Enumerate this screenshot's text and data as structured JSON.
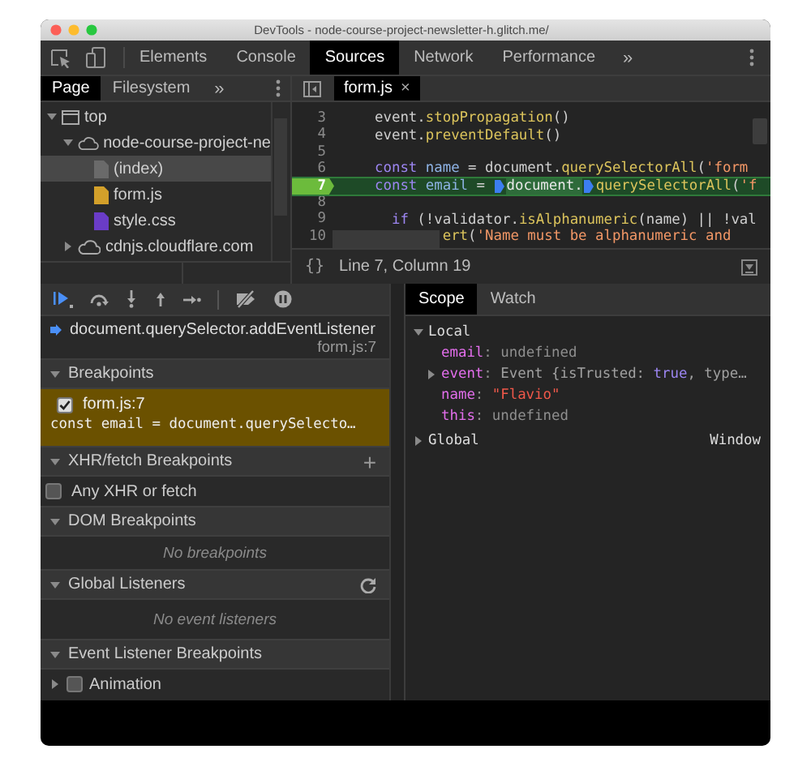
{
  "window": {
    "title": "DevTools - node-course-project-newsletter-h.glitch.me/"
  },
  "main_tabs": [
    {
      "label": "Elements",
      "selected": false
    },
    {
      "label": "Console",
      "selected": false
    },
    {
      "label": "Sources",
      "selected": true
    },
    {
      "label": "Network",
      "selected": false
    },
    {
      "label": "Performance",
      "selected": false
    }
  ],
  "more_tabs": "»",
  "navigator": {
    "tabs": [
      {
        "label": "Page",
        "selected": true
      },
      {
        "label": "Filesystem",
        "selected": false
      }
    ],
    "more_tabs": "»",
    "tree": [
      {
        "label": "top",
        "kind": "frame",
        "expanded": true,
        "selected": false,
        "children": [
          {
            "label": "node-course-project-ne",
            "kind": "domain",
            "expanded": true,
            "selected": false,
            "children": [
              {
                "label": "(index)",
                "kind": "document",
                "selected": true
              },
              {
                "label": "form.js",
                "kind": "script",
                "selected": false
              },
              {
                "label": "style.css",
                "kind": "stylesheet",
                "selected": false
              }
            ]
          },
          {
            "label": "cdnjs.cloudflare.com",
            "kind": "domain",
            "expanded": false,
            "selected": false
          }
        ]
      }
    ]
  },
  "editor": {
    "tabs": [
      {
        "label": "form.js",
        "selected": true,
        "close": "×"
      }
    ],
    "lines": [
      {
        "number": "3",
        "current": false,
        "tokens": [
          {
            "kind": "plain",
            "text": "event."
          },
          {
            "kind": "method",
            "text": "stopPropagation"
          },
          {
            "kind": "plain",
            "text": "()"
          }
        ]
      },
      {
        "number": "4",
        "current": false,
        "tokens": [
          {
            "kind": "plain",
            "text": "event."
          },
          {
            "kind": "method",
            "text": "preventDefault"
          },
          {
            "kind": "plain",
            "text": "()"
          }
        ]
      },
      {
        "number": "5",
        "current": false
      },
      {
        "number": "6",
        "current": false,
        "tokens": [
          {
            "kind": "keyword",
            "text": "const "
          },
          {
            "kind": "def",
            "text": "name"
          },
          {
            "kind": "plain",
            "text": " = document."
          },
          {
            "kind": "method",
            "text": "querySelectorAll"
          },
          {
            "kind": "plain",
            "text": "("
          },
          {
            "kind": "string",
            "text": "'form"
          }
        ]
      },
      {
        "number": "7",
        "current": true,
        "tokens": [
          {
            "kind": "keyword",
            "text": "const "
          },
          {
            "kind": "def",
            "text": "email"
          },
          {
            "kind": "plain",
            "text": " = "
          },
          {
            "kind": "marker"
          },
          {
            "kind": "highlight",
            "text": "document."
          },
          {
            "kind": "marker"
          },
          {
            "kind": "method",
            "text": "querySelectorAll"
          },
          {
            "kind": "plain",
            "text": "("
          },
          {
            "kind": "string",
            "text": "'f"
          }
        ]
      },
      {
        "number": "8",
        "current": false
      },
      {
        "number": "9",
        "current": false,
        "tokens": [
          {
            "kind": "keyword",
            "text": "  if "
          },
          {
            "kind": "plain",
            "text": "(!validator."
          },
          {
            "kind": "method",
            "text": "isAlphanumeric"
          },
          {
            "kind": "plain",
            "text": "(name) || !val"
          }
        ]
      },
      {
        "number": "10",
        "current": false,
        "tokens": [
          {
            "kind": "method",
            "text": "        ert"
          },
          {
            "kind": "plain",
            "text": "("
          },
          {
            "kind": "string",
            "text": "'Name must be alphanumeric and"
          }
        ]
      }
    ],
    "format_button": "{}",
    "status": "Line 7, Column 19"
  },
  "debugger": {
    "call_stack": [
      {
        "function": "document.querySelector.addEventListener",
        "location": "form.js:7",
        "current": true
      }
    ],
    "sections": [
      {
        "title": "Breakpoints",
        "expanded": true,
        "items": [
          {
            "kind": "breakpoint",
            "label": "form.js:7",
            "code": "const email = document.querySelecto…",
            "checked": true,
            "hit": true
          }
        ]
      },
      {
        "title": "XHR/fetch Breakpoints",
        "expanded": true,
        "action": {
          "kind": "add",
          "text": "+"
        },
        "items": [
          {
            "kind": "checkbox",
            "label": "Any XHR or fetch",
            "checked": false
          }
        ]
      },
      {
        "title": "DOM Breakpoints",
        "expanded": true,
        "empty_message": "No breakpoints"
      },
      {
        "title": "Global Listeners",
        "expanded": true,
        "action": {
          "kind": "refresh"
        },
        "empty_message": "No event listeners"
      },
      {
        "title": "Event Listener Breakpoints",
        "expanded": true,
        "items": [
          {
            "kind": "category",
            "label": "Animation",
            "checked": false,
            "expanded": false
          }
        ]
      }
    ]
  },
  "scope": {
    "tabs": [
      {
        "label": "Scope",
        "selected": true
      },
      {
        "label": "Watch",
        "selected": false
      }
    ],
    "scopes": [
      {
        "name": "Local",
        "expanded": true,
        "vars": [
          {
            "name": "email",
            "separator": ":",
            "expandable": false,
            "value": [
              {
                "kind": "undefined",
                "text": "undefined"
              }
            ]
          },
          {
            "name": "event",
            "separator": ":",
            "expandable": true,
            "expanded": false,
            "value": [
              {
                "kind": "object",
                "text": "Event {isTrusted: "
              },
              {
                "kind": "boolean",
                "text": "true"
              },
              {
                "kind": "object",
                "text": ", type…"
              }
            ]
          },
          {
            "name": "name",
            "separator": ":",
            "expandable": false,
            "value": [
              {
                "kind": "string",
                "text": "\"Flavio\""
              }
            ]
          },
          {
            "name": "this",
            "separator": ":",
            "expandable": false,
            "value": [
              {
                "kind": "undefined",
                "text": "undefined"
              }
            ]
          }
        ]
      },
      {
        "name": "Global",
        "expanded": false,
        "value": "Window"
      }
    ]
  }
}
